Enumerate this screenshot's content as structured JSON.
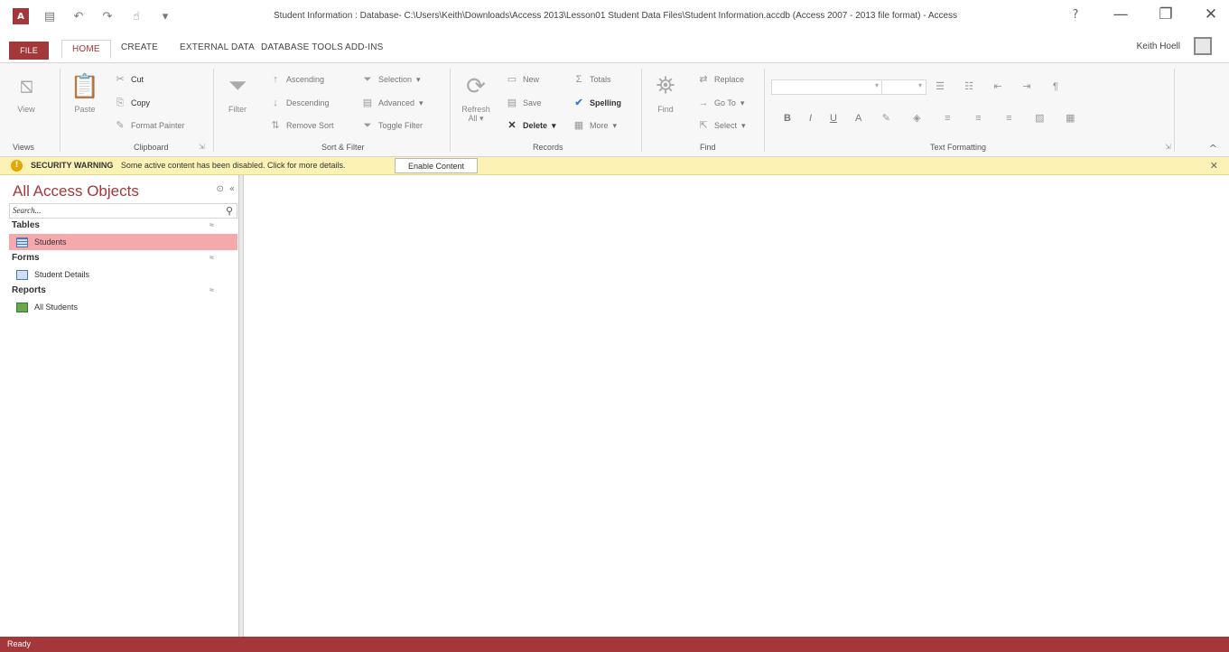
{
  "window": {
    "title": "Student Information : Database- C:\\Users\\Keith\\Downloads\\Access 2013\\Lesson01 Student Data Files\\Student Information.accdb (Access 2007 - 2013 file format) - Access",
    "help": "?",
    "user": "Keith Hoell",
    "logo": "A"
  },
  "qat_icons": [
    "save-icon",
    "undo-icon",
    "redo-icon",
    "touch-mode-icon",
    "customize-qat-icon"
  ],
  "tabs": [
    "FILE",
    "HOME",
    "CREATE",
    "EXTERNAL DATA",
    "DATABASE TOOLS",
    "ADD-INS"
  ],
  "ribbon": {
    "views": {
      "view": "View",
      "group": "Views"
    },
    "clipboard": {
      "paste": "Paste",
      "cut": "Cut",
      "copy": "Copy",
      "format_painter": "Format Painter",
      "group": "Clipboard"
    },
    "sort_filter": {
      "filter": "Filter",
      "ascending": "Ascending",
      "descending": "Descending",
      "remove_sort": "Remove Sort",
      "selection": "Selection",
      "advanced": "Advanced",
      "toggle_filter": "Toggle Filter",
      "group": "Sort & Filter"
    },
    "records": {
      "refresh": "Refresh",
      "refresh_all": "All",
      "new": "New",
      "save": "Save",
      "delete": "Delete",
      "totals": "Totals",
      "spelling": "Spelling",
      "more": "More",
      "group": "Records"
    },
    "find": {
      "find": "Find",
      "replace": "Replace",
      "goto": "Go To",
      "select": "Select",
      "group": "Find"
    },
    "text_formatting": {
      "bold": "B",
      "italic": "I",
      "underline": "U",
      "font_color": "A",
      "group": "Text Formatting"
    }
  },
  "security": {
    "title": "SECURITY WARNING",
    "message": "Some active content has been disabled. Click for more details.",
    "button": "Enable Content"
  },
  "nav": {
    "title": "All Access Objects",
    "search_placeholder": "Search...",
    "sections": [
      {
        "label": "Tables",
        "items": [
          "Students"
        ]
      },
      {
        "label": "Forms",
        "items": [
          "Student Details"
        ]
      },
      {
        "label": "Reports",
        "items": [
          "All Students"
        ]
      }
    ]
  },
  "status": {
    "text": "Ready"
  },
  "colors": {
    "accent": "#a4373a",
    "warning_bar": "#fdf2b5",
    "selected_item": "#f5a9ad"
  }
}
